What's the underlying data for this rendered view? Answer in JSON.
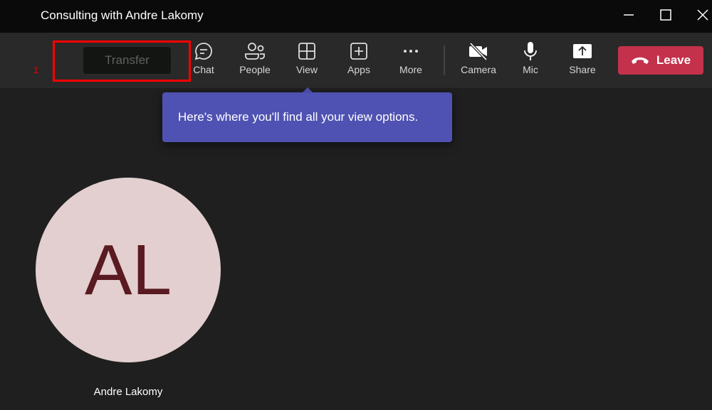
{
  "window": {
    "title": "Consulting with Andre Lakomy"
  },
  "annotation": {
    "marker": "1"
  },
  "toolbar": {
    "transfer": "Transfer",
    "chat": "Chat",
    "people": "People",
    "view": "View",
    "apps": "Apps",
    "more": "More",
    "camera": "Camera",
    "mic": "Mic",
    "share": "Share",
    "leave": "Leave"
  },
  "tooltip": {
    "text": "Here's where you'll find all your view options."
  },
  "participant": {
    "initials": "AL",
    "name": "Andre Lakomy"
  },
  "colors": {
    "leave": "#c4314b",
    "tooltip": "#4f52b2",
    "avatar_bg": "#e3cfcf",
    "avatar_text": "#5a1a22"
  }
}
